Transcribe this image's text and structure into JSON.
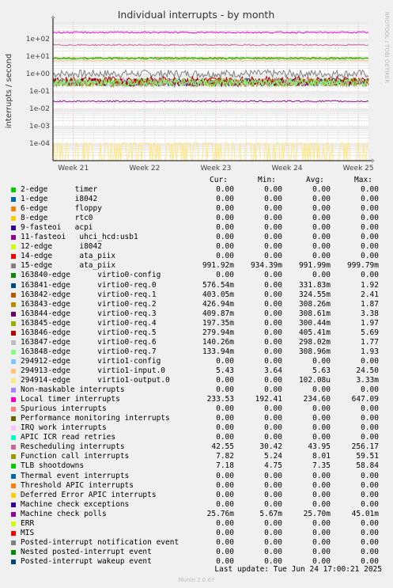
{
  "chart_data": {
    "type": "line",
    "title": "Individual interrupts - by month",
    "ylabel": "interrupts / second",
    "y_scale": "log",
    "ylim": [
      1e-05,
      1000
    ],
    "y_ticks": [
      "1e-04",
      "1e-03",
      "1e-02",
      "1e-01",
      "1e+00",
      "1e+01",
      "1e+02"
    ],
    "x_ticks": [
      "Week 21",
      "Week 22",
      "Week 23",
      "Week 24",
      "Week 25"
    ],
    "grid": true,
    "watermark": "RRDTOOL / TOBI OETIKER",
    "legend_columns": [
      "Cur:",
      "Min:",
      "Avg:",
      "Max:"
    ],
    "series": [
      {
        "name": "2-edge      timer",
        "color": "#00cc00",
        "cur": "0.00",
        "min": "0.00",
        "avg": "0.00",
        "max": "0.00"
      },
      {
        "name": "1-edge      i8042",
        "color": "#0066b3",
        "cur": "0.00",
        "min": "0.00",
        "avg": "0.00",
        "max": "0.00"
      },
      {
        "name": "6-edge      floppy",
        "color": "#ff8000",
        "cur": "0.00",
        "min": "0.00",
        "avg": "0.00",
        "max": "0.00"
      },
      {
        "name": "8-edge      rtc0",
        "color": "#ffcc00",
        "cur": "0.00",
        "min": "0.00",
        "avg": "0.00",
        "max": "0.00"
      },
      {
        "name": "9-fasteoi   acpi",
        "color": "#330099",
        "cur": "0.00",
        "min": "0.00",
        "avg": "0.00",
        "max": "0.00"
      },
      {
        "name": "11-fasteoi   uhci_hcd:usb1",
        "color": "#990099",
        "cur": "0.00",
        "min": "0.00",
        "avg": "0.00",
        "max": "0.00"
      },
      {
        "name": "12-edge      i8042",
        "color": "#ccff00",
        "cur": "0.00",
        "min": "0.00",
        "avg": "0.00",
        "max": "0.00"
      },
      {
        "name": "14-edge      ata_piix",
        "color": "#ff0000",
        "cur": "0.00",
        "min": "0.00",
        "avg": "0.00",
        "max": "0.00"
      },
      {
        "name": "15-edge      ata_piix",
        "color": "#808080",
        "cur": "991.92m",
        "min": "934.39m",
        "avg": "991.99m",
        "max": "999.79m"
      },
      {
        "name": "163840-edge      virtio0-config",
        "color": "#008f00",
        "cur": "0.00",
        "min": "0.00",
        "avg": "0.00",
        "max": "0.00"
      },
      {
        "name": "163841-edge      virtio0-req.0",
        "color": "#00487d",
        "cur": "576.54m",
        "min": "0.00",
        "avg": "331.83m",
        "max": "1.92"
      },
      {
        "name": "163842-edge      virtio0-req.1",
        "color": "#b35a00",
        "cur": "403.05m",
        "min": "0.00",
        "avg": "324.55m",
        "max": "2.41"
      },
      {
        "name": "163843-edge      virtio0-req.2",
        "color": "#b38f00",
        "cur": "426.94m",
        "min": "0.00",
        "avg": "308.26m",
        "max": "1.87"
      },
      {
        "name": "163844-edge      virtio0-req.3",
        "color": "#6b006b",
        "cur": "409.87m",
        "min": "0.00",
        "avg": "308.61m",
        "max": "3.38"
      },
      {
        "name": "163845-edge      virtio0-req.4",
        "color": "#8fb300",
        "cur": "197.35m",
        "min": "0.00",
        "avg": "300.44m",
        "max": "1.97"
      },
      {
        "name": "163846-edge      virtio0-req.5",
        "color": "#b30000",
        "cur": "279.94m",
        "min": "0.00",
        "avg": "405.41m",
        "max": "5.69"
      },
      {
        "name": "163847-edge      virtio0-req.6",
        "color": "#bebebe",
        "cur": "140.26m",
        "min": "0.00",
        "avg": "298.02m",
        "max": "1.77"
      },
      {
        "name": "163848-edge      virtio0-req.7",
        "color": "#80ff80",
        "cur": "133.94m",
        "min": "0.00",
        "avg": "308.96m",
        "max": "1.93"
      },
      {
        "name": "294912-edge      virtio1-config",
        "color": "#80c9ff",
        "cur": "0.00",
        "min": "0.00",
        "avg": "0.00",
        "max": "0.00"
      },
      {
        "name": "294913-edge      virtio1-input.0",
        "color": "#ffc080",
        "cur": "5.43",
        "min": "3.64",
        "avg": "5.63",
        "max": "24.50"
      },
      {
        "name": "294914-edge      virtio1-output.0",
        "color": "#ffe680",
        "cur": "0.00",
        "min": "0.00",
        "avg": "102.08u",
        "max": "3.33m"
      },
      {
        "name": "Non-maskable interrupts",
        "color": "#aa80ff",
        "cur": "0.00",
        "min": "0.00",
        "avg": "0.00",
        "max": "0.00"
      },
      {
        "name": "Local timer interrupts",
        "color": "#ee00cc",
        "cur": "233.53",
        "min": "192.41",
        "avg": "234.60",
        "max": "647.09"
      },
      {
        "name": "Spurious interrupts",
        "color": "#ff8080",
        "cur": "0.00",
        "min": "0.00",
        "avg": "0.00",
        "max": "0.00"
      },
      {
        "name": "Performance monitoring interrupts",
        "color": "#666600",
        "cur": "0.00",
        "min": "0.00",
        "avg": "0.00",
        "max": "0.00"
      },
      {
        "name": "IRQ work interrupts",
        "color": "#ffbfff",
        "cur": "0.00",
        "min": "0.00",
        "avg": "0.00",
        "max": "0.00"
      },
      {
        "name": "APIC ICR read retries",
        "color": "#00ffcc",
        "cur": "0.00",
        "min": "0.00",
        "avg": "0.00",
        "max": "0.00"
      },
      {
        "name": "Rescheduling interrupts",
        "color": "#cc6699",
        "cur": "42.55",
        "min": "30.42",
        "avg": "43.95",
        "max": "256.17"
      },
      {
        "name": "Function call interrupts",
        "color": "#999900",
        "cur": "7.82",
        "min": "5.24",
        "avg": "8.01",
        "max": "59.51"
      },
      {
        "name": "TLB shootdowns",
        "color": "#00cc00",
        "cur": "7.18",
        "min": "4.75",
        "avg": "7.35",
        "max": "58.84"
      },
      {
        "name": "Thermal event interrupts",
        "color": "#0066b3",
        "cur": "0.00",
        "min": "0.00",
        "avg": "0.00",
        "max": "0.00"
      },
      {
        "name": "Threshold APIC interrupts",
        "color": "#ff8000",
        "cur": "0.00",
        "min": "0.00",
        "avg": "0.00",
        "max": "0.00"
      },
      {
        "name": "Deferred Error APIC interrupts",
        "color": "#ffcc00",
        "cur": "0.00",
        "min": "0.00",
        "avg": "0.00",
        "max": "0.00"
      },
      {
        "name": "Machine check exceptions",
        "color": "#330099",
        "cur": "0.00",
        "min": "0.00",
        "avg": "0.00",
        "max": "0.00"
      },
      {
        "name": "Machine check polls",
        "color": "#990099",
        "cur": "25.76m",
        "min": "5.67m",
        "avg": "25.70m",
        "max": "45.01m"
      },
      {
        "name": "ERR",
        "color": "#ccff00",
        "cur": "0.00",
        "min": "0.00",
        "avg": "0.00",
        "max": "0.00"
      },
      {
        "name": "MIS",
        "color": "#ff0000",
        "cur": "0.00",
        "min": "0.00",
        "avg": "0.00",
        "max": "0.00"
      },
      {
        "name": "Posted-interrupt notification event",
        "color": "#808080",
        "cur": "0.00",
        "min": "0.00",
        "avg": "0.00",
        "max": "0.00"
      },
      {
        "name": "Nested posted-interrupt event",
        "color": "#008f00",
        "cur": "0.00",
        "min": "0.00",
        "avg": "0.00",
        "max": "0.00"
      },
      {
        "name": "Posted-interrupt wakeup event",
        "color": "#00487d",
        "cur": "0.00",
        "min": "0.00",
        "avg": "0.00",
        "max": "0.00"
      }
    ],
    "last_update": "Last update: Tue Jun 24 17:00:21 2025",
    "footer": "Munin 2.0.67"
  }
}
